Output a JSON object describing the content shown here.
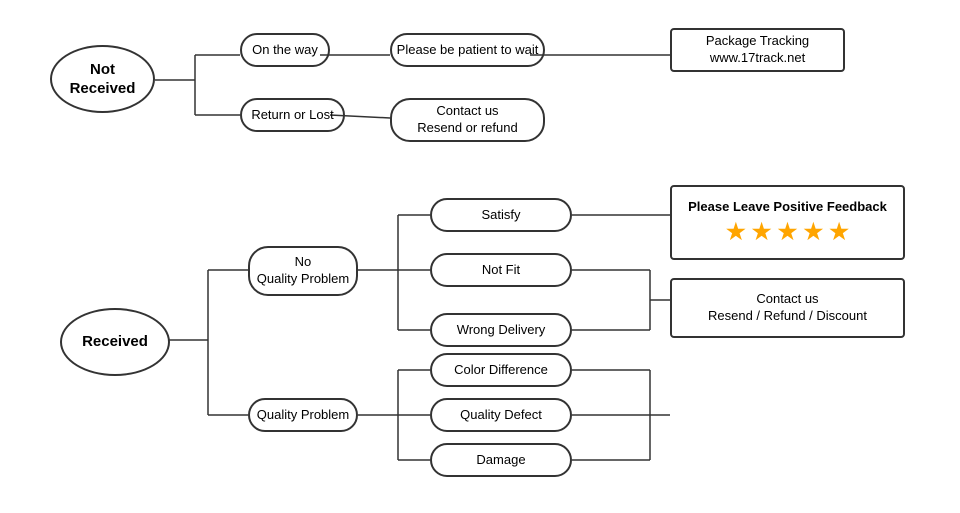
{
  "nodes": {
    "not_received": {
      "label": "Not\nReceived"
    },
    "on_the_way": {
      "label": "On the way"
    },
    "return_or_lost": {
      "label": "Return or Lost"
    },
    "patient_wait": {
      "label": "Please be patient to wait"
    },
    "package_tracking": {
      "label": "Package Tracking\nwww.17track.net"
    },
    "contact_resend_refund": {
      "label": "Contact us\nResend or refund"
    },
    "received": {
      "label": "Received"
    },
    "no_quality_problem": {
      "label": "No\nQuality Problem"
    },
    "quality_problem": {
      "label": "Quality Problem"
    },
    "satisfy": {
      "label": "Satisfy"
    },
    "not_fit": {
      "label": "Not Fit"
    },
    "wrong_delivery": {
      "label": "Wrong Delivery"
    },
    "color_difference": {
      "label": "Color Difference"
    },
    "quality_defect": {
      "label": "Quality Defect"
    },
    "damage": {
      "label": "Damage"
    },
    "positive_feedback": {
      "label": "Please Leave Positive Feedback"
    },
    "contact_resend_discount": {
      "label": "Contact us\nResend / Refund / Discount"
    }
  },
  "stars": "★ ★ ★ ★ ★"
}
